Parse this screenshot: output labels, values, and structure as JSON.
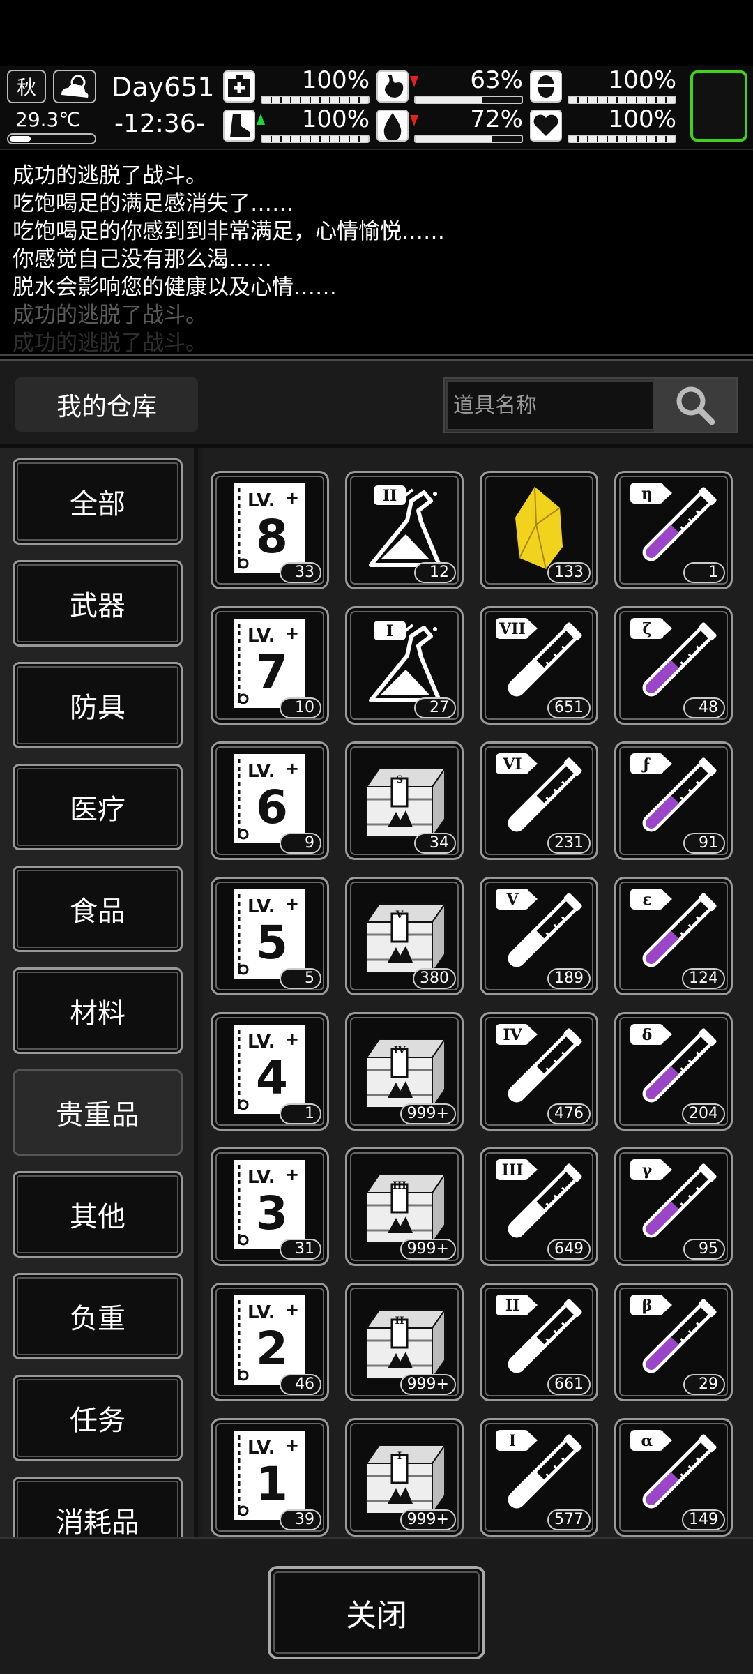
{
  "status": {
    "season": "秋",
    "temperature": "29.3℃",
    "day": "Day651",
    "time": "-12:36-",
    "stats": [
      {
        "name": "health",
        "icon": "first-aid-icon",
        "value": "100%"
      },
      {
        "name": "hunger",
        "icon": "stomach-icon",
        "value": "63%",
        "trend": "down"
      },
      {
        "name": "armor",
        "icon": "shield-icon",
        "value": "100%"
      },
      {
        "name": "stamina",
        "icon": "boot-icon",
        "value": "100%",
        "trend": "up"
      },
      {
        "name": "thirst",
        "icon": "water-drop-icon",
        "value": "72%",
        "trend": "down"
      },
      {
        "name": "mood",
        "icon": "heart-icon",
        "value": "100%"
      }
    ]
  },
  "log": [
    "成功的逃脱了战斗。",
    "吃饱喝足的满足感消失了……",
    "吃饱喝足的你感到到非常满足，心情愉悦……",
    "你感觉自己没有那么渴……",
    "脱水会影响您的健康以及心情……",
    "成功的逃脱了战斗。",
    "成功的逃脱了战斗。"
  ],
  "warehouse": {
    "title": "我的仓库",
    "search_placeholder": "道具名称"
  },
  "categories": [
    "全部",
    "武器",
    "防具",
    "医疗",
    "食品",
    "材料",
    "贵重品",
    "其他",
    "负重",
    "任务",
    "消耗品"
  ],
  "active_category": "贵重品",
  "items": [
    [
      {
        "icon": "skill-book-icon",
        "label": "8",
        "count": "33"
      },
      {
        "icon": "flask-icon",
        "label": "II",
        "count": "12"
      },
      {
        "icon": "gold-crystal-icon",
        "label": "",
        "count": "133"
      },
      {
        "icon": "purple-vial-icon",
        "label": "η",
        "count": "1"
      }
    ],
    [
      {
        "icon": "skill-book-icon",
        "label": "7",
        "count": "10"
      },
      {
        "icon": "flask-icon",
        "label": "I",
        "count": "27"
      },
      {
        "icon": "white-vial-icon",
        "label": "VII",
        "count": "651"
      },
      {
        "icon": "purple-vial-icon",
        "label": "ζ",
        "count": "48"
      }
    ],
    [
      {
        "icon": "skill-book-icon",
        "label": "6",
        "count": "9"
      },
      {
        "icon": "treasure-chest-icon",
        "label": "S",
        "count": "34"
      },
      {
        "icon": "white-vial-icon",
        "label": "VI",
        "count": "231"
      },
      {
        "icon": "purple-vial-icon",
        "label": "ϝ",
        "count": "91"
      }
    ],
    [
      {
        "icon": "skill-book-icon",
        "label": "5",
        "count": "5"
      },
      {
        "icon": "treasure-chest-icon",
        "label": "V",
        "count": "380"
      },
      {
        "icon": "white-vial-icon",
        "label": "V",
        "count": "189"
      },
      {
        "icon": "purple-vial-icon",
        "label": "ε",
        "count": "124"
      }
    ],
    [
      {
        "icon": "skill-book-icon",
        "label": "4",
        "count": "1"
      },
      {
        "icon": "treasure-chest-icon",
        "label": "IV",
        "count": "999+"
      },
      {
        "icon": "white-vial-icon",
        "label": "IV",
        "count": "476"
      },
      {
        "icon": "purple-vial-icon",
        "label": "δ",
        "count": "204"
      }
    ],
    [
      {
        "icon": "skill-book-icon",
        "label": "3",
        "count": "31"
      },
      {
        "icon": "treasure-chest-icon",
        "label": "III",
        "count": "999+"
      },
      {
        "icon": "white-vial-icon",
        "label": "III",
        "count": "649"
      },
      {
        "icon": "purple-vial-icon",
        "label": "γ",
        "count": "95"
      }
    ],
    [
      {
        "icon": "skill-book-icon",
        "label": "2",
        "count": "46"
      },
      {
        "icon": "treasure-chest-icon",
        "label": "II",
        "count": "999+"
      },
      {
        "icon": "white-vial-icon",
        "label": "II",
        "count": "661"
      },
      {
        "icon": "purple-vial-icon",
        "label": "β",
        "count": "29"
      }
    ],
    [
      {
        "icon": "skill-book-icon",
        "label": "1",
        "count": "39"
      },
      {
        "icon": "treasure-chest-icon",
        "label": "I",
        "count": "999+"
      },
      {
        "icon": "white-vial-icon",
        "label": "I",
        "count": "577"
      },
      {
        "icon": "purple-vial-icon",
        "label": "α",
        "count": "149"
      }
    ]
  ],
  "close_label": "关闭",
  "colors": {
    "accent_green": "#43d21a",
    "vial_purple": "#9b45c8",
    "gold": "#f1d21c",
    "trend_up": "#19d83a",
    "trend_down": "#e42020"
  }
}
